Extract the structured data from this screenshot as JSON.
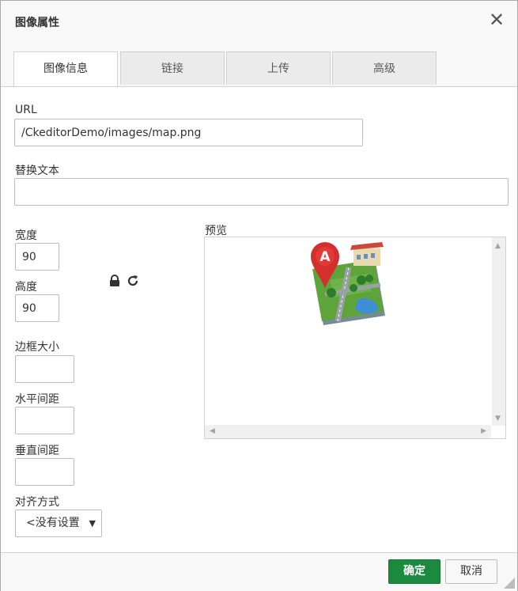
{
  "dialog": {
    "title": "图像属性"
  },
  "tabs": [
    {
      "label": "图像信息",
      "active": true
    },
    {
      "label": "链接",
      "active": false
    },
    {
      "label": "上传",
      "active": false
    },
    {
      "label": "高级",
      "active": false
    }
  ],
  "fields": {
    "url": {
      "label": "URL",
      "value": "/CkeditorDemo/images/map.png"
    },
    "alt": {
      "label": "替换文本",
      "value": ""
    },
    "width": {
      "label": "宽度",
      "value": "90"
    },
    "height": {
      "label": "高度",
      "value": "90"
    },
    "border": {
      "label": "边框大小",
      "value": ""
    },
    "hspace": {
      "label": "水平间距",
      "value": ""
    },
    "vspace": {
      "label": "垂直间距",
      "value": ""
    },
    "align": {
      "label": "对齐方式",
      "value": "<没有设置"
    }
  },
  "preview": {
    "label": "预览",
    "image_icon": "map-pin-icon"
  },
  "footer": {
    "ok_label": "确定",
    "cancel_label": "取消"
  },
  "colors": {
    "ok_button": "#1b8a3f",
    "border": "#d1d1d1",
    "header_bg": "#f8f8f8"
  }
}
